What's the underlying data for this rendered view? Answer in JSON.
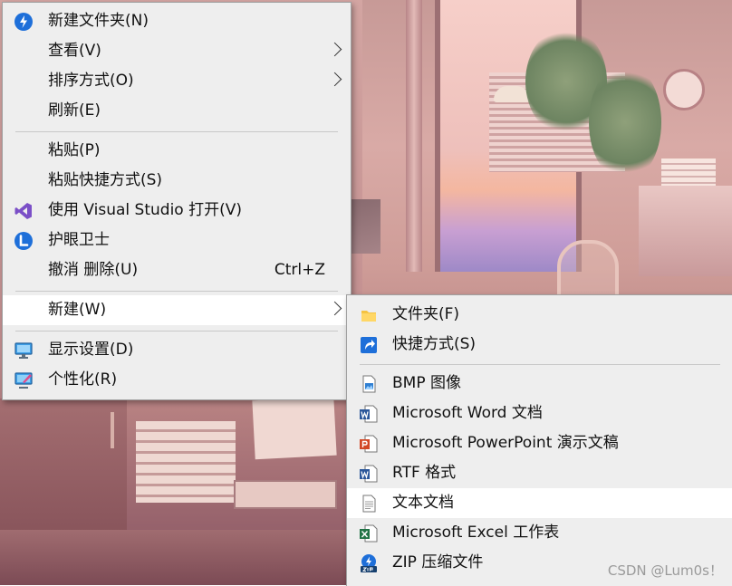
{
  "main_menu": {
    "items": [
      {
        "label": "新建文件夹(N)",
        "icon": "new-folder-app-icon"
      },
      {
        "label": "查看(V)"
      },
      {
        "label": "排序方式(O)"
      },
      {
        "label": "刷新(E)"
      },
      {
        "label": "粘贴(P)"
      },
      {
        "label": "粘贴快捷方式(S)"
      },
      {
        "label": "使用 Visual Studio 打开(V)",
        "icon": "visual-studio-icon"
      },
      {
        "label": "护眼卫士",
        "icon": "eye-guard-icon"
      },
      {
        "label": "撤消 删除(U)",
        "shortcut": "Ctrl+Z"
      },
      {
        "label": "新建(W)",
        "highlighted": true
      },
      {
        "label": "显示设置(D)",
        "icon": "display-settings-icon"
      },
      {
        "label": "个性化(R)",
        "icon": "personalize-icon"
      }
    ]
  },
  "sub_menu": {
    "items": [
      {
        "label": "文件夹(F)",
        "icon": "folder-icon"
      },
      {
        "label": "快捷方式(S)",
        "icon": "shortcut-icon"
      },
      {
        "label": "BMP 图像",
        "icon": "bmp-image-icon"
      },
      {
        "label": "Microsoft Word 文档",
        "icon": "word-icon"
      },
      {
        "label": "Microsoft PowerPoint 演示文稿",
        "icon": "powerpoint-icon"
      },
      {
        "label": "RTF 格式",
        "icon": "rtf-icon"
      },
      {
        "label": "文本文档",
        "icon": "text-document-icon",
        "highlighted": true
      },
      {
        "label": "Microsoft Excel 工作表",
        "icon": "excel-icon"
      },
      {
        "label": "ZIP 压缩文件",
        "icon": "zip-icon"
      }
    ]
  },
  "watermark": "CSDN @Lum0s！",
  "colors": {
    "menu_bg": "#eeeeee",
    "highlight_bg": "#ffffff",
    "accent_blue": "#1e6fd9",
    "vs_purple": "#7b4fc7"
  }
}
